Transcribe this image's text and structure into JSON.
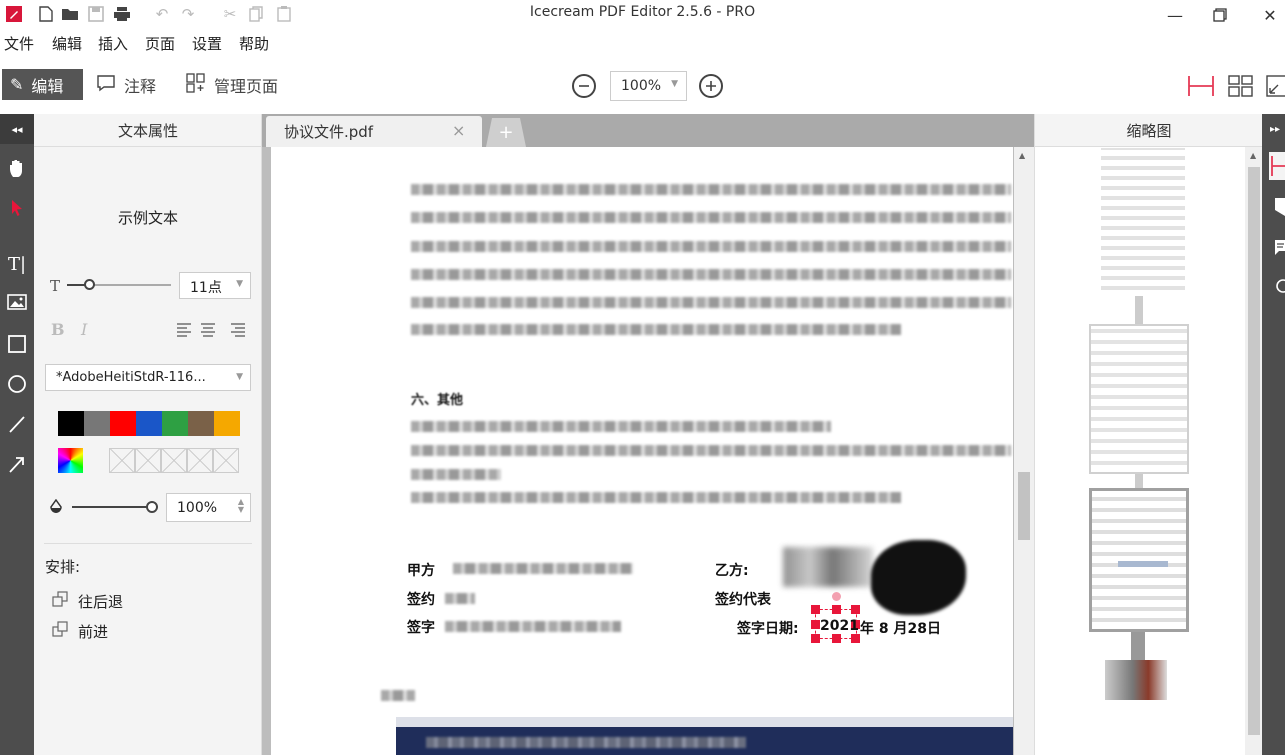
{
  "window": {
    "title": "Icecream PDF Editor 2.5.6 - PRO",
    "minimize_icon": "minimize-icon",
    "maximize_icon": "restore-icon",
    "close_icon": "close-icon"
  },
  "menu": {
    "items": [
      "文件",
      "编辑",
      "插入",
      "页面",
      "设置",
      "帮助"
    ]
  },
  "toolbar": {
    "edit_label": "编辑",
    "annotate_label": "注释",
    "manage_pages_label": "管理页面",
    "zoom_value": "100%"
  },
  "props_panel": {
    "title": "文本属性",
    "sample_text": "示例文本",
    "font_size": "11点",
    "bold_label": "B",
    "italic_label": "I",
    "font_name": "*AdobeHeitiStdR-116...",
    "colors": [
      "#000000",
      "#777777",
      "#ff0000",
      "#1a56c8",
      "#2ea043",
      "#7a6148",
      "#f5a800"
    ],
    "opacity_value": "100%",
    "arrange_label": "安排:",
    "send_back_label": "往后退",
    "bring_forward_label": "前进"
  },
  "tabs": {
    "doc_tab_label": "协议文件.pdf",
    "close_label": "×",
    "add_label": "+"
  },
  "document": {
    "section_heading": "六、其他",
    "party_a_label": "甲方",
    "signer_label": "签约",
    "sign_date_label": "签字",
    "party_b_label": "乙方:",
    "signer_rep_label": "签约代表",
    "sign_date_b_prefix": "签字日期:",
    "sign_date_year": "2021",
    "sign_date_rest": "年 8 月28日"
  },
  "thumbs_panel": {
    "title": "缩略图"
  }
}
